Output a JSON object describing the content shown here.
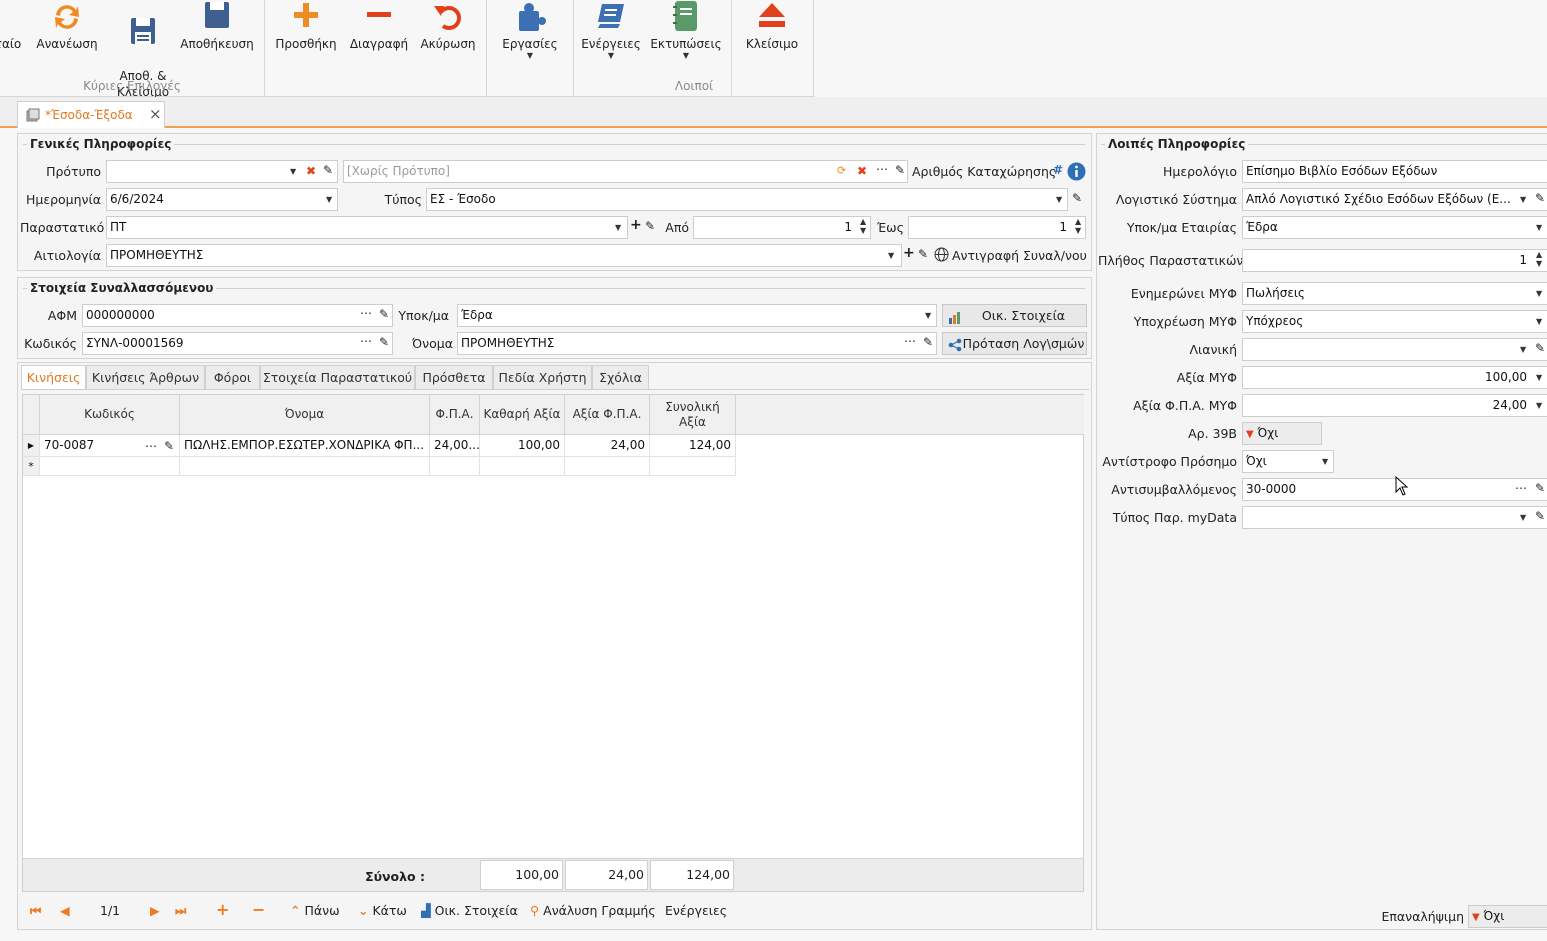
{
  "ribbon": {
    "buttons": [
      {
        "label": "ταίο",
        "icon": "new-doc-icon"
      },
      {
        "label": "Ανανέωση",
        "icon": "refresh-icon"
      },
      {
        "label": "Αποθ. &\nΚλείσιμο",
        "icon": "save-close-icon"
      },
      {
        "label": "Αποθήκευση",
        "icon": "save-icon"
      },
      {
        "label": "Προσθήκη",
        "icon": "plus-icon"
      },
      {
        "label": "Διαγραφή",
        "icon": "minus-icon"
      },
      {
        "label": "Ακύρωση",
        "icon": "undo-icon"
      },
      {
        "label": "Εργασίες",
        "icon": "puzzle-icon"
      },
      {
        "label": "Ενέργειες",
        "icon": "actions-icon"
      },
      {
        "label": "Εκτυπώσεις",
        "icon": "notebook-icon"
      },
      {
        "label": "Κλείσιμο",
        "icon": "eject-icon"
      }
    ],
    "groups": {
      "main": "Κύριες Επιλογές",
      "other": "Λοιποί"
    }
  },
  "doc_tab": {
    "title": "*Έσοδα-Έξοδα",
    "close": "×"
  },
  "general": {
    "title": "Γενικές Πληροφορίες",
    "template_label": "Πρότυπο",
    "template_value": "",
    "template_placeholder": "[Χωρίς Πρότυπο]",
    "reg_number_label": "Αριθμός Καταχώρησης",
    "reg_number_hash": "#",
    "date_label": "Ημερομηνία",
    "date_value": "6/6/2024",
    "type_label": "Τύπος",
    "type_value": "ΕΣ - Έσοδο",
    "doc_label": "Παραστατικό",
    "doc_value": "ΠΤ",
    "from_label": "Από",
    "from_value": "1",
    "to_label": "Έως",
    "to_value": "1",
    "reason_label": "Αιτιολογία",
    "reason_value": "ΠΡΟΜΗΘΕΥΤΗΣ",
    "copy_label": "Αντιγραφή Συναλ/νου"
  },
  "party": {
    "title": "Στοιχεία Συναλλασσόμενου",
    "afm_label": "ΑΦΜ",
    "afm_value": "000000000",
    "branch_label": "Υποκ/μα",
    "branch_value": "Έδρα",
    "fin_btn": "Οικ. Στοιχεία",
    "code_label": "Κωδικός",
    "code_value": "ΣΥΝΛ-00001569",
    "name_label": "Όνομα",
    "name_value": "ΠΡΟΜΗΘΕΥΤΗΣ",
    "suggest_btn": "Πρόταση Λογ\\σμών"
  },
  "tabs": [
    "Κινήσεις",
    "Κινήσεις Άρθρων",
    "Φόροι",
    "Στοιχεία Παραστατικού",
    "Πρόσθετα",
    "Πεδία Χρήστη",
    "Σχόλια"
  ],
  "grid": {
    "columns": [
      "Κωδικός",
      "Όνομα",
      "Φ.Π.Α.",
      "Καθαρή Αξία",
      "Αξία Φ.Π.Α.",
      "Συνολική\nΑξία"
    ],
    "rows": [
      {
        "code": "70-0087",
        "name": "ΠΩΛΗΣ.ΕΜΠΟΡ.ΕΣΩΤΕΡ.ΧΟΝΔΡΙΚΑ ΦΠ...",
        "vat": "24,00...",
        "net": "100,00",
        "vat_amount": "24,00",
        "total": "124,00"
      }
    ],
    "new_row_marker": "*",
    "totals_label": "Σύνολο :",
    "totals": {
      "net": "100,00",
      "vat": "24,00",
      "total": "124,00"
    }
  },
  "navigator": {
    "page": "1/1",
    "up": "Πάνω",
    "down": "Κάτω",
    "fin": "Οικ. Στοιχεία",
    "analysis": "Ανάλυση Γραμμής",
    "actions": "Ενέργειες"
  },
  "other": {
    "title": "Λοιπές Πληροφορίες",
    "journal_label": "Ημερολόγιο",
    "journal_value": "Επίσημο Βιβλίο Εσόδων Εξόδων",
    "acc_label": "Λογιστικό Σύστημα",
    "acc_value": "Απλό Λογιστικό Σχέδιο Εσόδων Εξόδων (Ε...",
    "branch_label": "Υποκ/μα Εταιρίας",
    "branch_value": "Έδρα",
    "count_label": "Πλήθος Παραστατικών",
    "count_value": "1",
    "myf_label": "Ενημερώνει ΜΥΦ",
    "myf_value": "Πωλήσεις",
    "oblig_label": "Υποχρέωση ΜΥΦ",
    "oblig_value": "Υπόχρεος",
    "retail_label": "Λιανική",
    "retail_value": "",
    "myf_amount_label": "Αξία ΜΥΦ",
    "myf_amount_value": "100,00",
    "myf_vat_label": "Αξία Φ.Π.Α. ΜΥΦ",
    "myf_vat_value": "24,00",
    "art39_label": "Αρ. 39Β",
    "art39_value": "Όχι",
    "reverse_label": "Αντίστροφο Πρόσημο",
    "reverse_value": "Όχι",
    "counter_label": "Αντισυμβαλλόμενος",
    "counter_value": "30-0000",
    "mydata_label": "Τύπος Παρ. myData",
    "mydata_value": "",
    "repeat_label": "Επαναλήψιμη",
    "repeat_value": "Όχι"
  },
  "colors": {
    "accent": "#e07a24",
    "red": "#e0411b",
    "blue": "#2f6fb3"
  }
}
